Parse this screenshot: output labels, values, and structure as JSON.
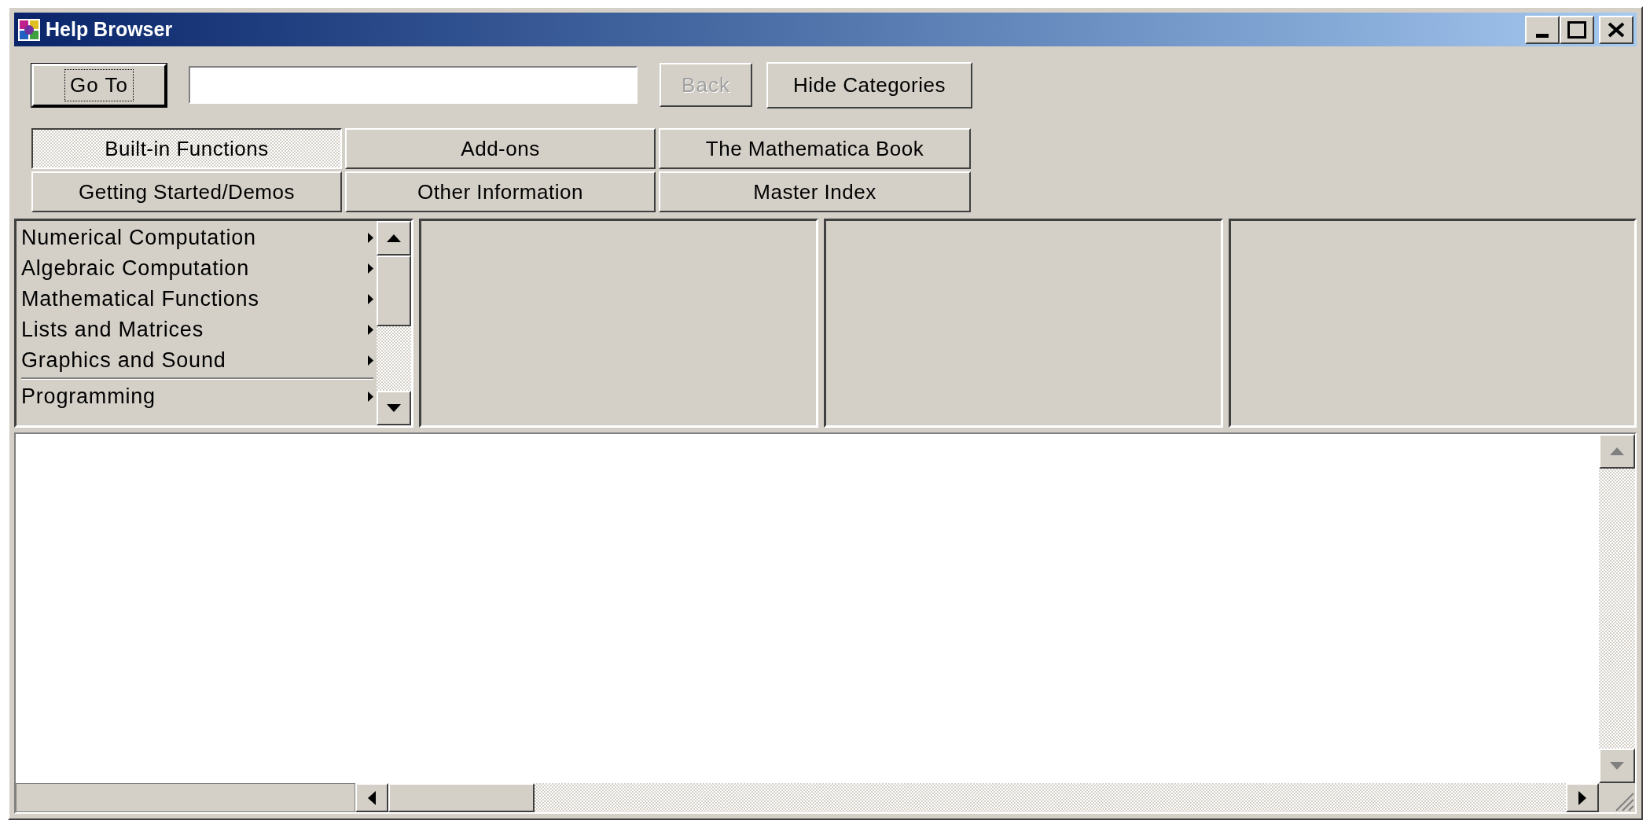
{
  "window": {
    "title": "Help Browser"
  },
  "toolbar": {
    "go_to": {
      "label": "Go To"
    },
    "back": {
      "label": "Back",
      "disabled": true
    },
    "hide_categories": {
      "label": "Hide Categories"
    }
  },
  "tabs": [
    {
      "label": "Built-in Functions",
      "selected": true
    },
    {
      "label": "Add-ons",
      "selected": false
    },
    {
      "label": "The Mathematica Book",
      "selected": false
    },
    {
      "label": "Getting Started/Demos",
      "selected": false
    },
    {
      "label": "Other Information",
      "selected": false
    },
    {
      "label": "Master Index",
      "selected": false
    }
  ],
  "categories": [
    {
      "label": "Numerical Computation",
      "separator_before": false
    },
    {
      "label": "Algebraic Computation",
      "separator_before": false
    },
    {
      "label": "Mathematical Functions",
      "separator_before": false
    },
    {
      "label": "Lists and Matrices",
      "separator_before": false
    },
    {
      "label": "Graphics and Sound",
      "separator_before": false
    },
    {
      "label": "Programming",
      "separator_before": true
    }
  ]
}
